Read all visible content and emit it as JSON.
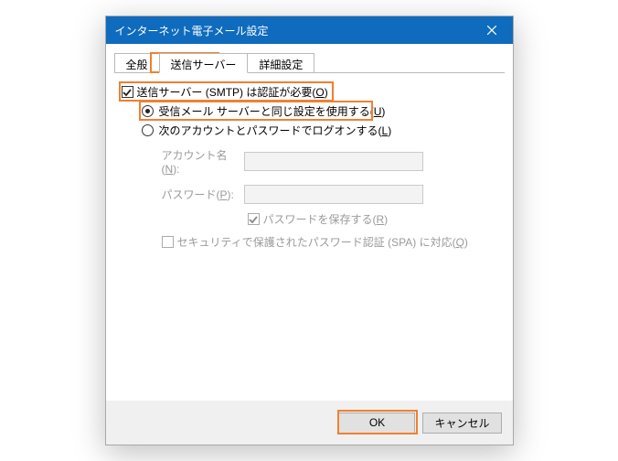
{
  "title": "インターネット電子メール設定",
  "tabs": {
    "general": "全般",
    "outgoing": "送信サーバー",
    "advanced": "詳細設定"
  },
  "form": {
    "smtp_auth_label": "送信サーバー (SMTP) は認証が必要(",
    "smtp_auth_key": "O",
    "smtp_auth_label_close": ")",
    "use_same_label": "受信メール サーバーと同じ設定を使用する(",
    "use_same_key": "U",
    "use_same_label_close": ")",
    "logon_other_label": "次のアカウントとパスワードでログオンする(",
    "logon_other_key": "L",
    "logon_other_label_close": ")",
    "account_label": "アカウント名(",
    "account_key": "N",
    "account_label_close": "):",
    "password_label": "パスワード(",
    "password_key": "P",
    "password_label_close": "):",
    "save_password_label": "パスワードを保存する(",
    "save_password_key": "R",
    "save_password_label_close": ")",
    "spa_label": "セキュリティで保護されたパスワード認証 (SPA) に対応(",
    "spa_key": "Q",
    "spa_label_close": ")"
  },
  "footer": {
    "ok": "OK",
    "cancel": "キャンセル"
  }
}
